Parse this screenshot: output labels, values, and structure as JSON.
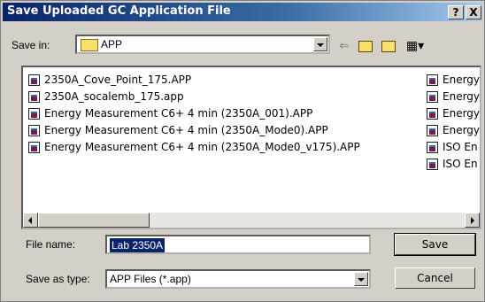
{
  "window": {
    "title": "Save Uploaded GC Application File",
    "help_label": "?",
    "close_label": "X"
  },
  "toolbar": {
    "save_in_label": "Save in:",
    "folder": "APP",
    "back_icon": "back-arrow-icon",
    "up_icon": "up-folder-icon",
    "new_folder_icon": "new-folder-icon",
    "views_icon": "view-menu-icon"
  },
  "files": {
    "column1": [
      "2350A_Cove_Point_175.APP",
      "2350A_socalemb_175.app",
      "Energy Measurement C6+ 4 min (2350A_001).APP",
      "Energy Measurement C6+ 4 min (2350A_Mode0).APP",
      "Energy Measurement C6+ 4 min (2350A_Mode0_v175).APP"
    ],
    "column2": [
      "Energy",
      "Energy",
      "Energy",
      "Energy",
      "ISO En",
      "ISO En"
    ]
  },
  "form": {
    "file_name_label": "File name:",
    "file_name_value": "Lab 2350A",
    "save_type_label": "Save as type:",
    "save_type_value": "APP Files (*.app)"
  },
  "buttons": {
    "save": "Save",
    "cancel": "Cancel"
  }
}
